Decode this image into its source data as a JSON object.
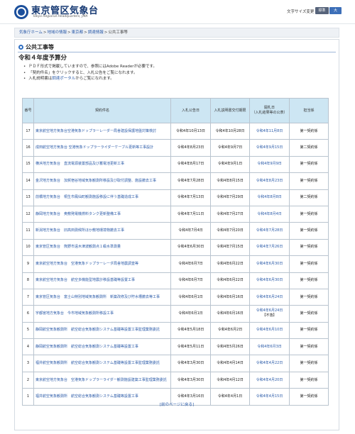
{
  "header": {
    "site_title": "東京管区気象台",
    "site_subtitle": "Tokyo Regional Headquarters, JMA",
    "font_size_label": "文字サイズ変更",
    "font_standard": "標準",
    "font_large": "大"
  },
  "breadcrumb": {
    "items": [
      "気象庁ホーム",
      "地域の情報",
      "東京都",
      "調達情報"
    ],
    "current": "公共工事等",
    "separator": ">"
  },
  "main": {
    "section_title": "公共工事等",
    "page_title": "令和４年度予算分",
    "notes": [
      "ＰＤＦ形式で掲載していますので、参照にはAdobe Readerが必要です。",
      "「契約件名」をクリックすると、入札公告をご覧になれます。"
    ],
    "note3_prefix": "入札説明書は",
    "note3_link": "調達ポータル",
    "note3_suffix": "からご覧になれます。"
  },
  "table": {
    "headers": {
      "no": "番号",
      "name": "契約件名",
      "notice_date": "入札公告日",
      "briefing_date": "入札説明書交付期限",
      "open_date": "開札日",
      "open_date_note": "（入札結果等の公表）",
      "dept": "担当係"
    },
    "rows": [
      {
        "no": "17",
        "name": "東京航空地方気象台空港気象ドップラーレーダー局舎建設保護地盤対策検討",
        "notice": "令和4年10月13日",
        "briefing": "令和4年10月28日",
        "open": "令和4年11月8日",
        "note": "",
        "dept": "第一契約係"
      },
      {
        "no": "16",
        "name": "成田航空地方気象台 空港気象ドップラーライダーケーブル更新等工事設計",
        "notice": "令和4年8月23日",
        "briefing": "令和4年9月7日",
        "open": "令和4年9月15日",
        "note": "",
        "dept": "第二契約係"
      },
      {
        "no": "15",
        "name": "横浜地方気象台　直流電源装置部品及び蓄電池更新工事",
        "notice": "令和4年8月17日",
        "briefing": "令和4年9月1日",
        "open": "令和4年9月9日",
        "note": "",
        "dept": "第一契約係"
      },
      {
        "no": "14",
        "name": "金沢地方気象台　加賀宿谷地域気象観測所移設及び取付調整、施設撤去工事",
        "notice": "令和4年7月28日",
        "briefing": "令和4年8月15日",
        "open": "令和4年8月23日",
        "note": "",
        "dept": "第一契約係"
      },
      {
        "no": "13",
        "name": "前橋地方気象台　桐生市鳳仙町観測施設移設に伴う基礎造成工事",
        "notice": "令和4年7月13日",
        "briefing": "令和4年7月29日",
        "open": "令和4年8月8日",
        "note": "",
        "dept": "第二契約係"
      },
      {
        "no": "12",
        "name": "静岡地方気象台　奥敷発電機燃料タンク更新整備工事",
        "notice": "令和4年7月11日",
        "briefing": "令和4年7月27日",
        "open": "令和4年8月4日",
        "note": "",
        "dept": "第一契約係"
      },
      {
        "no": "11",
        "name": "新潟地方気象台　旧高田測候所ほか敷地環境物撤去工事",
        "notice": "令和4年7月4日",
        "briefing": "令和4年7月20日",
        "open": "令和4年7月28日",
        "note": "",
        "dept": "第一契約係"
      },
      {
        "no": "10",
        "name": "東京管区気象台　熊野市遠木津波観測点１級水準測量",
        "notice": "令和4年6月30日",
        "briefing": "令和4年7月15日",
        "open": "令和4年7月26日",
        "note": "",
        "dept": "第一契約係"
      },
      {
        "no": "9",
        "name": "東京航空地方気象台　空港気象ドップラーレーダ局舎地震調査等",
        "notice": "令和4年6月7日",
        "briefing": "令和4年6月22日",
        "open": "令和4年6月30日",
        "note": "",
        "dept": "第一契約係"
      },
      {
        "no": "8",
        "name": "東京航空地方気象台　航空多機能型地震計移設基礎等設置工事",
        "notice": "令和4年6月7日",
        "briefing": "令和4年6月22日",
        "open": "令和4年6月30日",
        "note": "",
        "dept": "第一契約係"
      },
      {
        "no": "7",
        "name": "東京管区気象台　富士山特別地域気象観測所　新築改修及び貯水槽撤去等工事",
        "notice": "令和4年6月1日",
        "briefing": "令和4年6月16日",
        "open": "令和4年6月24日",
        "note": "",
        "dept": "第一契約係"
      },
      {
        "no": "6",
        "name": "宇都宮地方気象台　今市地域気象観測所移設工事",
        "notice": "令和4年6月1日",
        "briefing": "令和4年6月16日",
        "open": "令和4年6月24日",
        "note": "【不落】",
        "dept": "第一契約係"
      },
      {
        "no": "5",
        "name": "静岡航空気象観測所　航空総合気象観測システム基礎等設置工事監理業務委託",
        "notice": "令和4年5月18日",
        "briefing": "令和4年6月2日",
        "open": "令和4年6月10日",
        "note": "",
        "dept": "第一契約係"
      },
      {
        "no": "4",
        "name": "静岡航空気象観測所　航空総合気象観測システム基礎等設置工事",
        "notice": "令和4年5月11日",
        "briefing": "令和4年5月26日",
        "open": "令和4年6月3日",
        "note": "",
        "dept": "第一契約係"
      },
      {
        "no": "3",
        "name": "福井航空気象観測所　航空総合気象観測システム基礎等設置工事監理業務委託",
        "notice": "令和4年3月30日",
        "briefing": "令和4年4月14日",
        "open": "令和4年4月22日",
        "note": "",
        "dept": "第一契約係"
      },
      {
        "no": "2",
        "name": "東京航空地方気象台　空港気象ドップラーライダー観測施設建築工事監理業務委託",
        "notice": "令和4年3月30日",
        "briefing": "令和4年4月12日",
        "open": "令和4年4月20日",
        "note": "",
        "dept": "第一契約係"
      },
      {
        "no": "1",
        "name": "福井航空気象観測所　航空総合気象観測システム基礎等設置工事",
        "notice": "令和4年3月16日",
        "briefing": "令和4年4月1日",
        "open": "令和4年4月15日",
        "note": "",
        "dept": "第一契約係"
      }
    ]
  },
  "footer": {
    "back_link": "[前のページに戻る]"
  },
  "colors": {
    "link": "#2a5aa8",
    "header_cell": "#cde6f3",
    "brand": "#173a74"
  }
}
